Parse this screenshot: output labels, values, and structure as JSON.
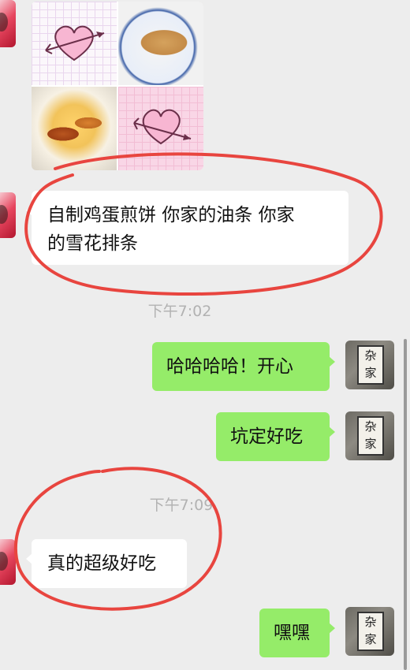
{
  "image_message": {
    "description_icons": [
      "heart-arrow-icon",
      "heart-arrow-icon"
    ],
    "photos": [
      "pancake-photo",
      "fried-dough-photo"
    ]
  },
  "messages": [
    {
      "side": "left",
      "text_line1": "自制鸡蛋煎饼 你家的油条 你家",
      "text_line2": "的雪花排条"
    },
    {
      "side": "right",
      "text": "哈哈哈哈！开心"
    },
    {
      "side": "right",
      "text": "坑定好吃"
    },
    {
      "side": "left",
      "text": "真的超级好吃"
    },
    {
      "side": "right",
      "text": "嘿嘿"
    }
  ],
  "timestamps": [
    "下午7:02",
    "下午7:09"
  ],
  "avatar_right_sign": [
    "杂",
    "家"
  ],
  "colors": {
    "background": "#ededed",
    "bubble_sent": "#95ec69",
    "bubble_received": "#ffffff",
    "annotation": "#e8453f"
  }
}
